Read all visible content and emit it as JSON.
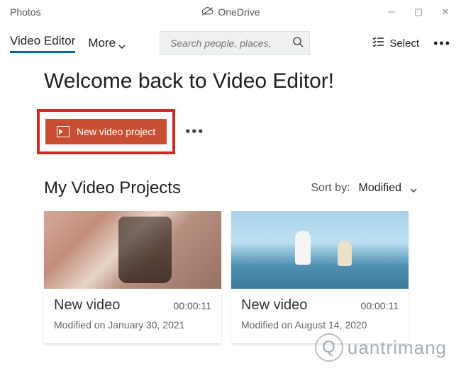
{
  "titlebar": {
    "app": "Photos",
    "cloud_label": "OneDrive"
  },
  "toolbar": {
    "tab_active": "Video Editor",
    "more_label": "More",
    "search_placeholder": "Search people, places,",
    "select_label": "Select"
  },
  "welcome": "Welcome back to Video Editor!",
  "new_project_label": "New video project",
  "section": {
    "title": "My Video Projects",
    "sort_label": "Sort by:",
    "sort_value": "Modified"
  },
  "projects": [
    {
      "title": "New video",
      "duration": "00:00:11",
      "modified": "Modified on January 30, 2021"
    },
    {
      "title": "New video",
      "duration": "00:00:11",
      "modified": "Modified on August 14, 2020"
    }
  ],
  "watermark": {
    "text": "uantrimang",
    "badge": "Q"
  }
}
